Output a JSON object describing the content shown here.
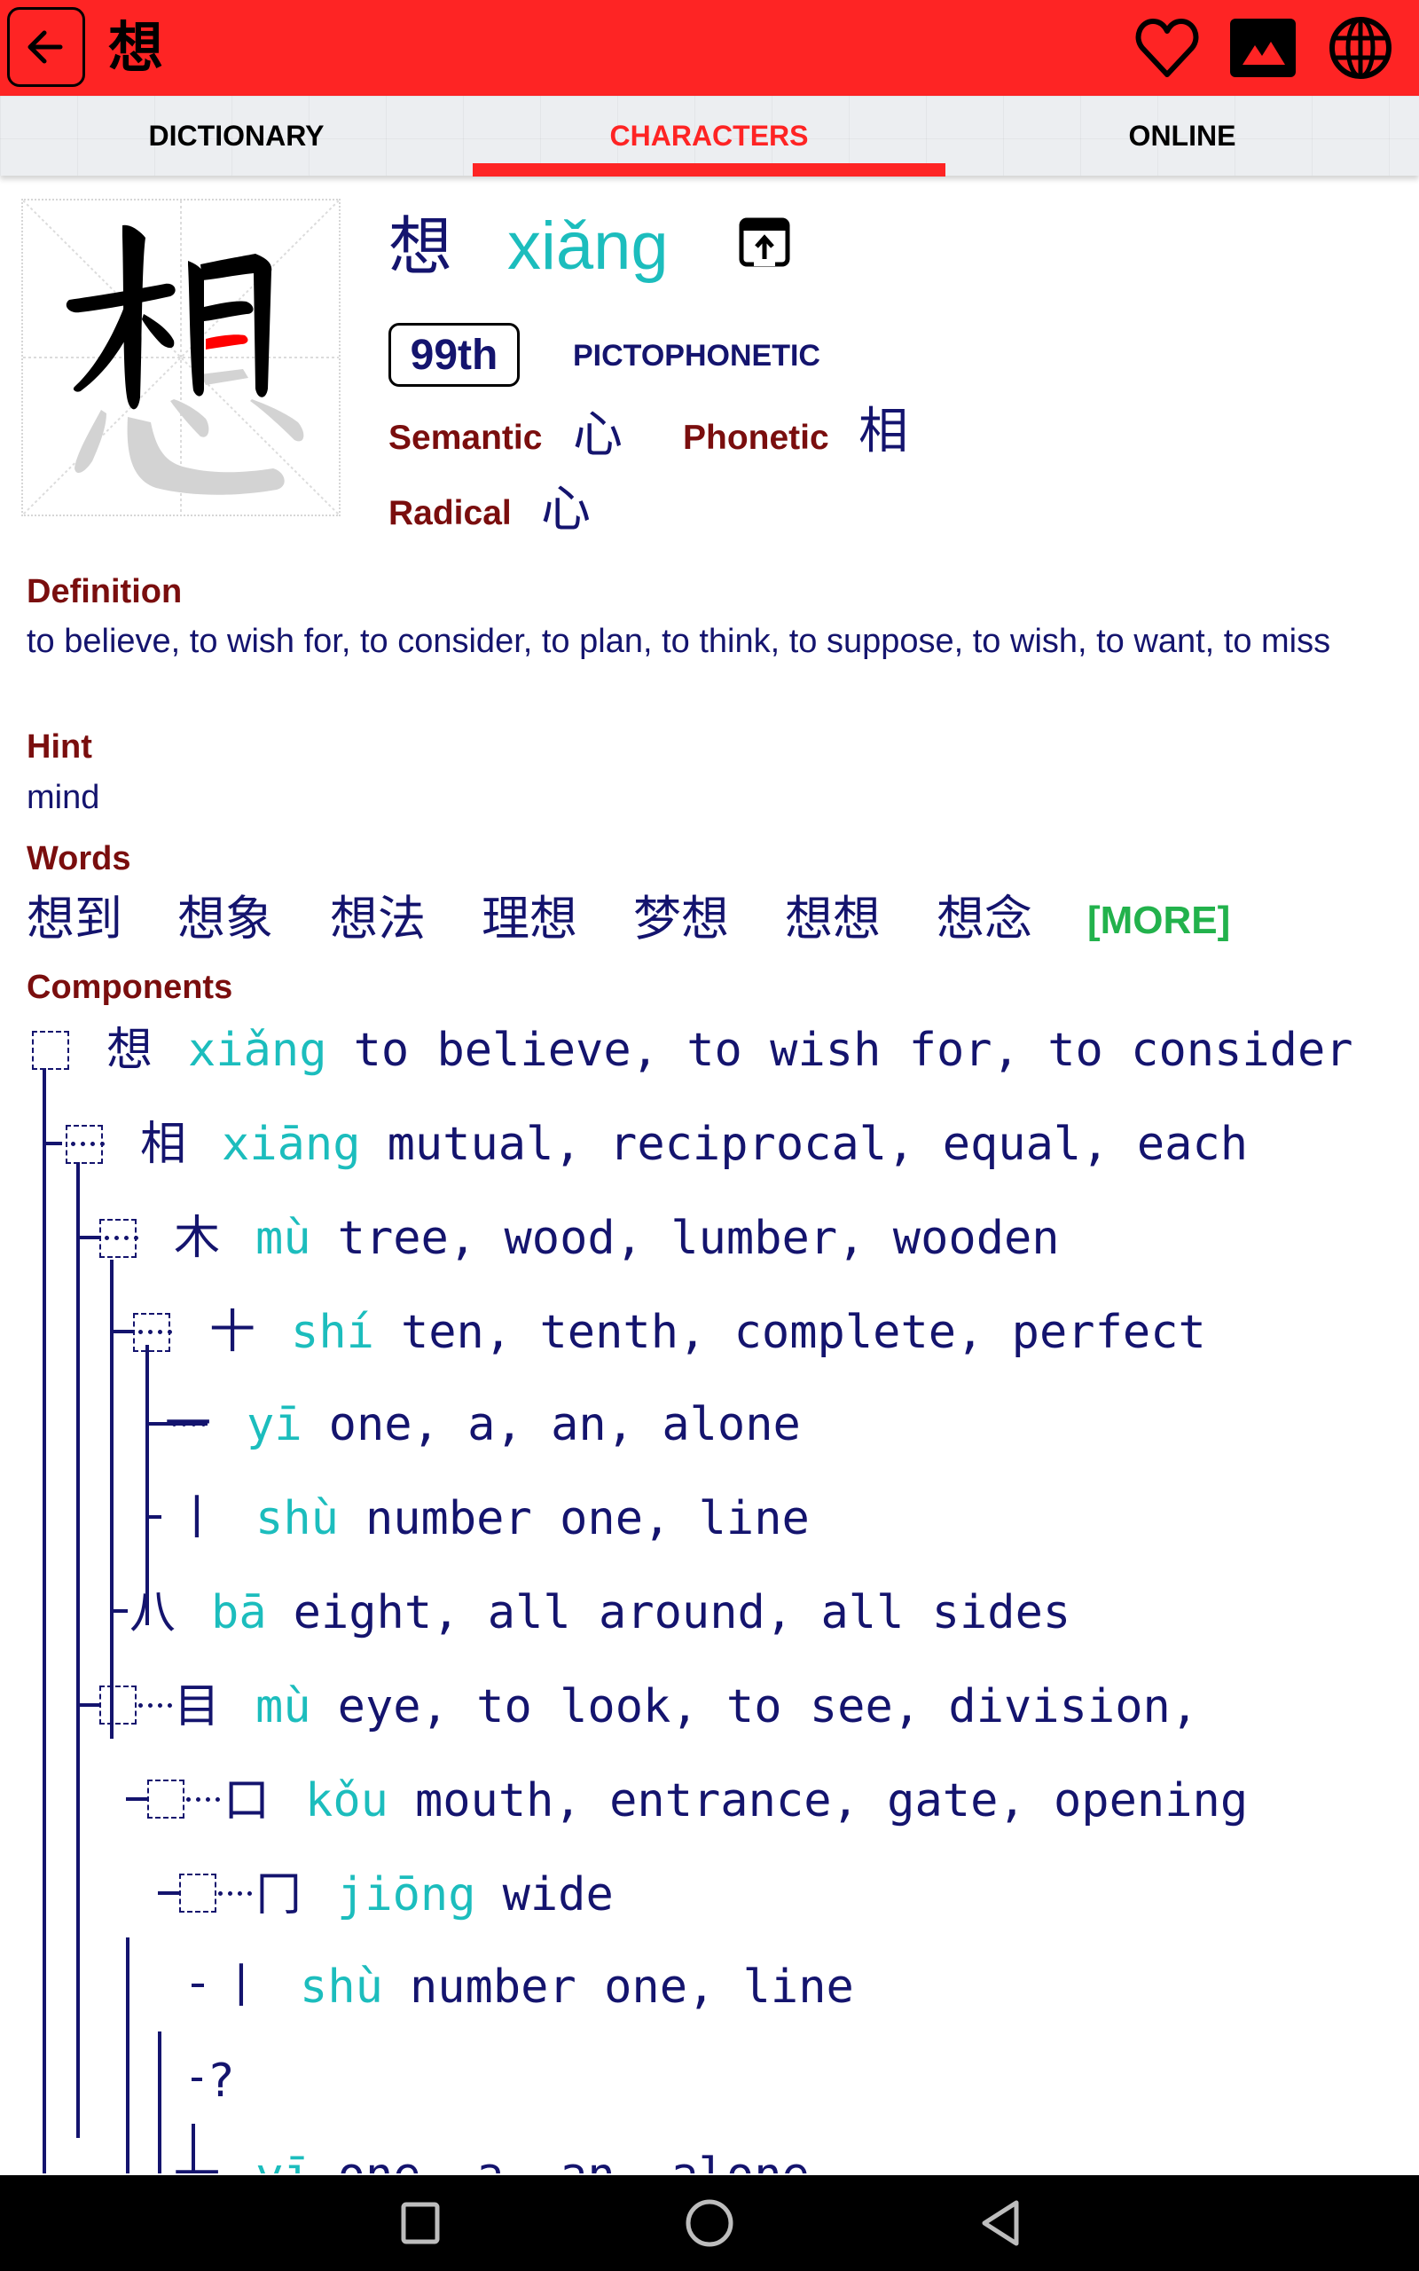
{
  "app_bar": {
    "title": "想",
    "back_icon": "arrow-left-icon",
    "actions": [
      {
        "name": "favorite",
        "icon": "heart-outline-icon"
      },
      {
        "name": "image",
        "icon": "image-icon"
      },
      {
        "name": "web",
        "icon": "globe-icon"
      }
    ]
  },
  "tabs": [
    {
      "label": "DICTIONARY",
      "active": false
    },
    {
      "label": "CHARACTERS",
      "active": true
    },
    {
      "label": "ONLINE",
      "active": false
    }
  ],
  "character": {
    "hanzi": "想",
    "pinyin": "xiǎng",
    "open_icon": "open-external-icon",
    "rank": "99th",
    "type": "PICTOPHONETIC",
    "semantic_label": "Semantic",
    "semantic": "心",
    "phonetic_label": "Phonetic",
    "phonetic": "相",
    "radical_label": "Radical",
    "radical": "心",
    "stroke_animation": {
      "current_stroke_color": "#ff0000",
      "done_color": "#000000",
      "pending_color": "#d3d3d3"
    }
  },
  "definition": {
    "title": "Definition",
    "text": "to believe, to wish for, to consider, to plan, to think, to suppose, to wish, to want, to miss"
  },
  "hint": {
    "title": "Hint",
    "text": "mind"
  },
  "words": {
    "title": "Words",
    "items": [
      "想到",
      "想象",
      "想法",
      "理想",
      "梦想",
      "想想",
      "想念"
    ],
    "more_label": "[MORE]"
  },
  "components": {
    "title": "Components",
    "rows": [
      {
        "char": "想",
        "pinyin": "xiǎng",
        "meaning": "to believe,  to wish for,  to consider"
      },
      {
        "char": "相",
        "pinyin": "xiāng",
        "meaning": "mutual,  reciprocal,  equal,  each"
      },
      {
        "char": "木",
        "pinyin": "mù",
        "meaning": "tree,  wood,  lumber,  wooden"
      },
      {
        "char": "十",
        "pinyin": "shí",
        "meaning": "ten,  tenth,  complete,  perfect"
      },
      {
        "char": "一",
        "pinyin": "yī",
        "meaning": "one,  a,  an,  alone"
      },
      {
        "char": "丨",
        "pinyin": "shù",
        "meaning": "number one,  line"
      },
      {
        "char": "八",
        "pinyin": "bā",
        "meaning": "eight,  all around,  all sides"
      },
      {
        "char": "目",
        "pinyin": "mù",
        "meaning": "eye,  to look,  to see,  division,"
      },
      {
        "char": "口",
        "pinyin": "kǒu",
        "meaning": "mouth,  entrance,  gate,  opening"
      },
      {
        "char": "冂",
        "pinyin": "jiōng",
        "meaning": "wide"
      },
      {
        "char": "丨",
        "pinyin": "shù",
        "meaning": "number one,  line"
      },
      {
        "char": "?",
        "pinyin": "",
        "meaning": ""
      },
      {
        "char": "一",
        "pinyin": "yī",
        "meaning": "one,  a,  an,  alone"
      }
    ]
  },
  "nav_bar": {
    "buttons": [
      {
        "name": "recents",
        "icon": "square-icon"
      },
      {
        "name": "home",
        "icon": "circle-icon"
      },
      {
        "name": "back",
        "icon": "triangle-back-icon"
      }
    ]
  },
  "colors": {
    "brand_red": "#fe2424",
    "navy_text": "#14146e",
    "pinyin_teal": "#1cbdbd",
    "label_maroon": "#7a0e0e",
    "more_green": "#22b24c"
  }
}
